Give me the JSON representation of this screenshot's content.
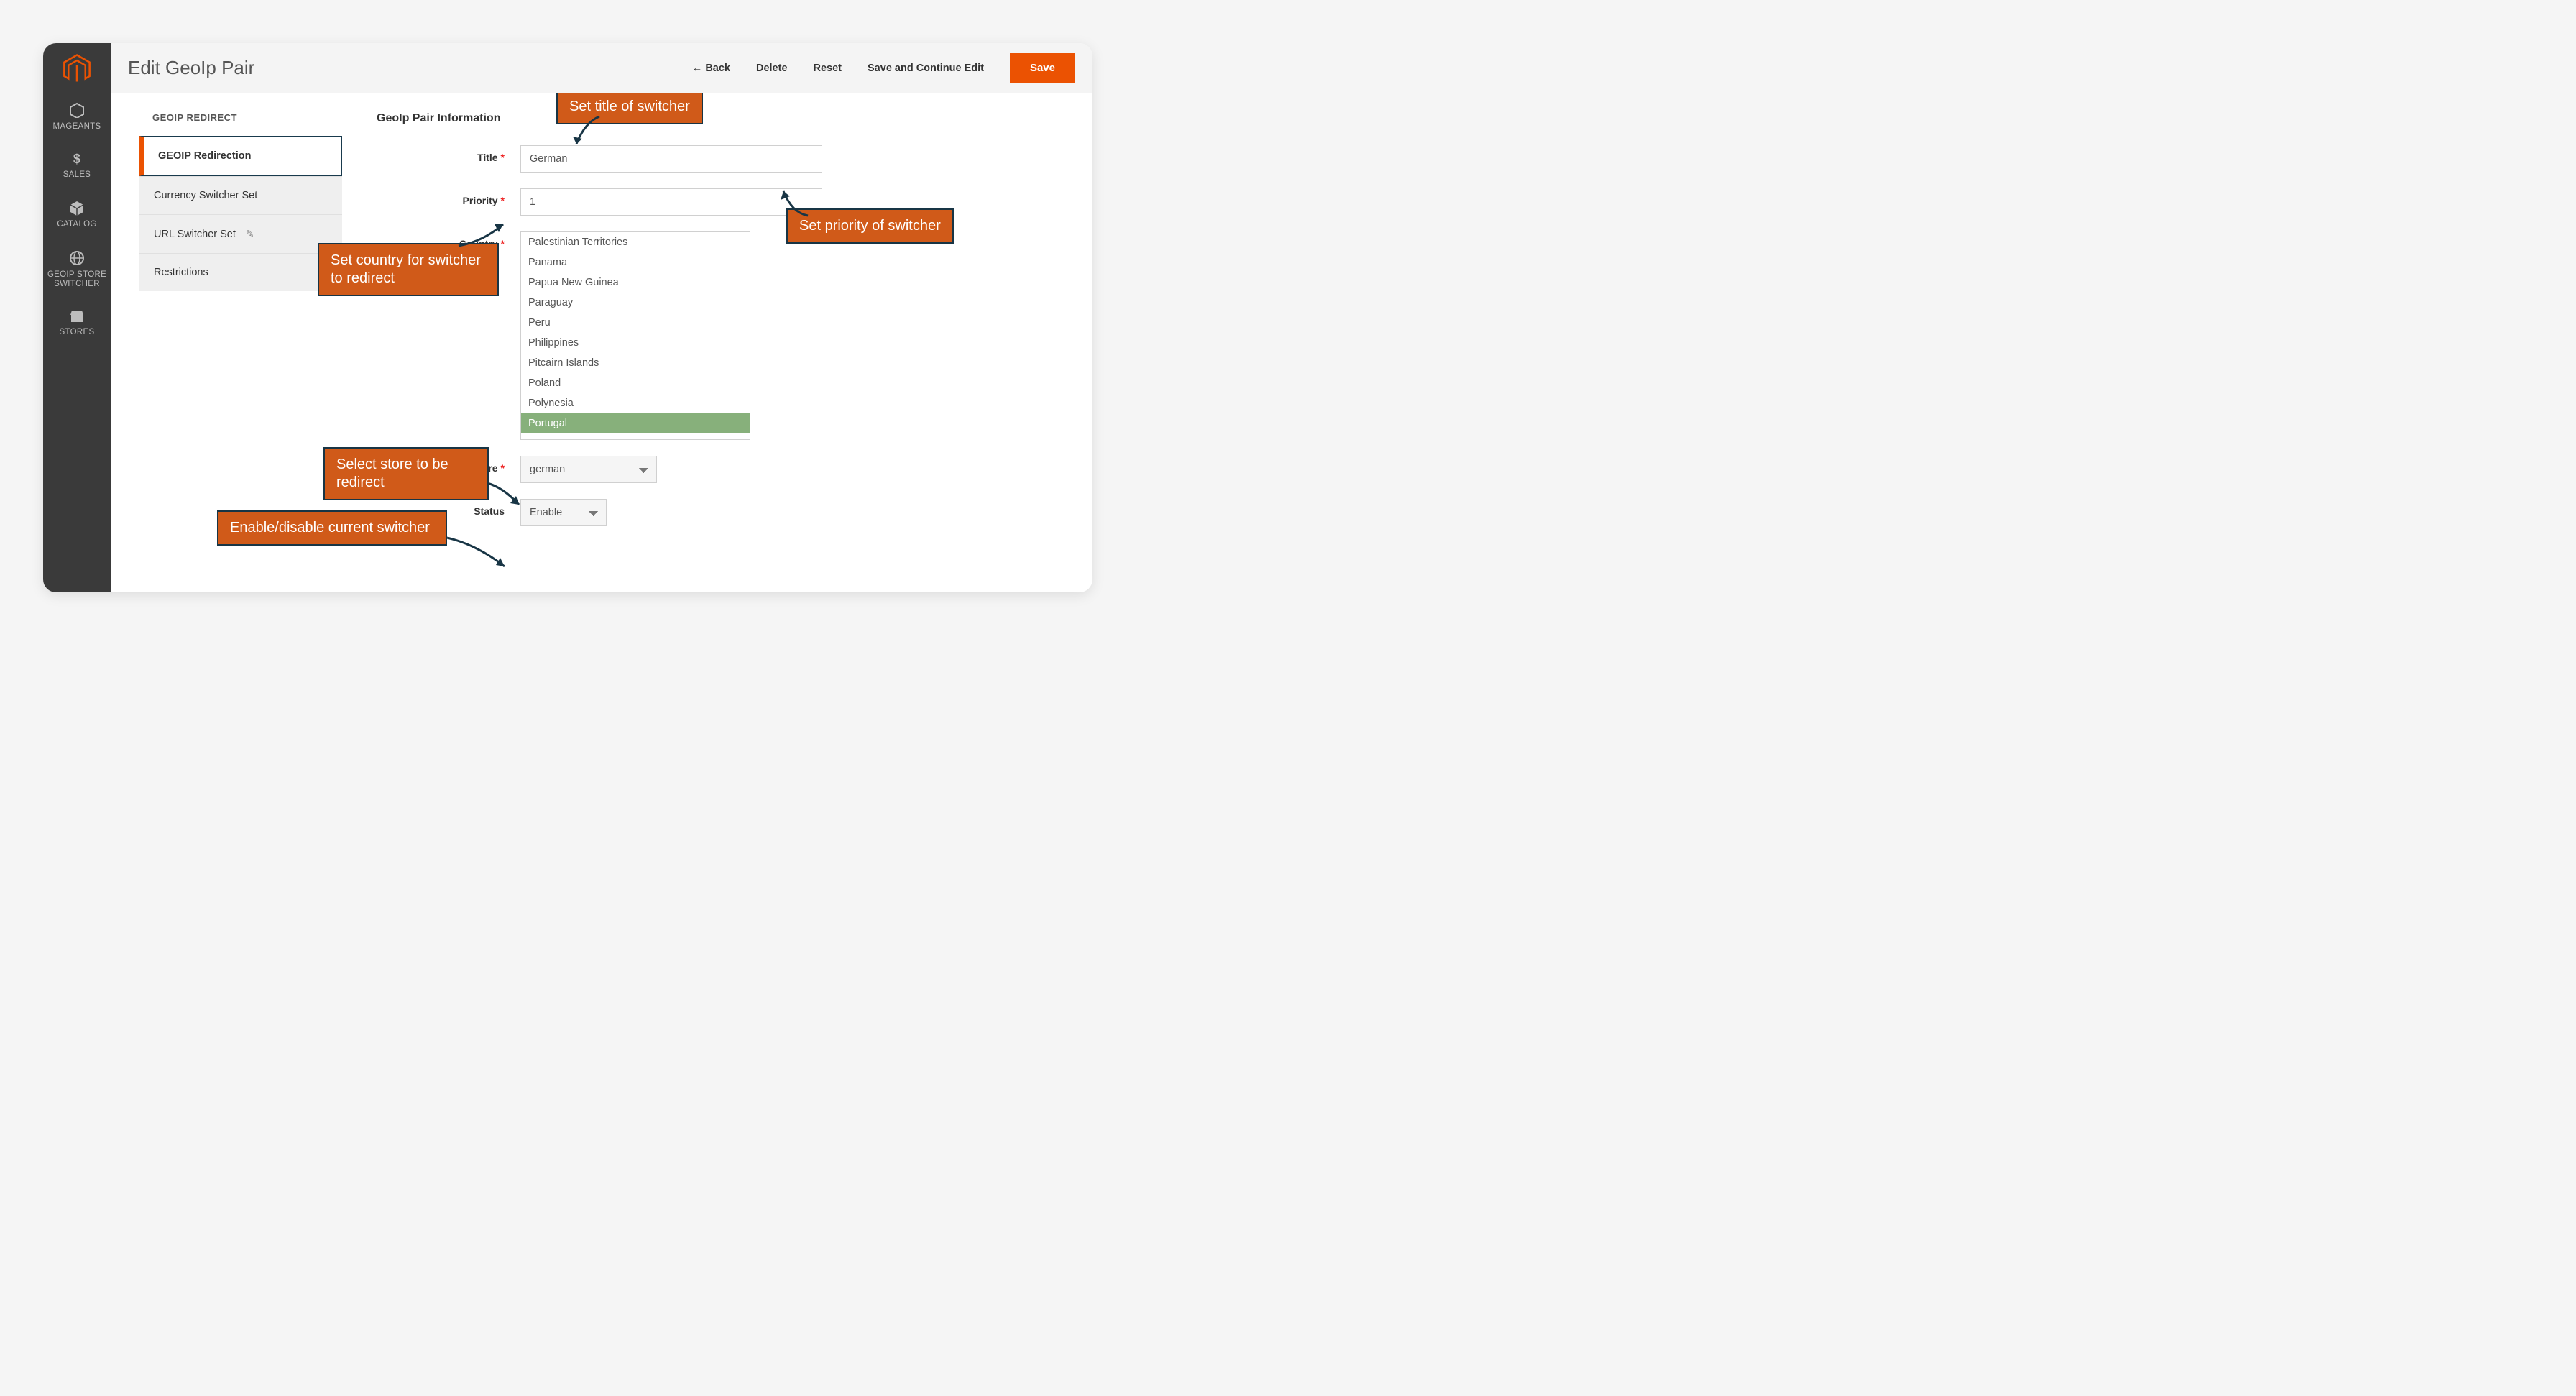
{
  "sidebar": {
    "items": [
      {
        "label": "MAGEANTS"
      },
      {
        "label": "SALES"
      },
      {
        "label": "CATALOG"
      },
      {
        "label": "GEOIP STORE SWITCHER"
      },
      {
        "label": "STORES"
      }
    ]
  },
  "header": {
    "title": "Edit GeoIp Pair",
    "back": "Back",
    "delete": "Delete",
    "reset": "Reset",
    "save_continue": "Save and Continue Edit",
    "save": "Save"
  },
  "tabs": {
    "heading": "GEOIP REDIRECT",
    "items": [
      {
        "label": "GEOIP Redirection",
        "active": true
      },
      {
        "label": "Currency Switcher Set"
      },
      {
        "label": "URL Switcher Set",
        "edit": true
      },
      {
        "label": "Restrictions"
      }
    ]
  },
  "form": {
    "section_title": "GeoIp Pair Information",
    "labels": {
      "title": "Title",
      "priority": "Priority",
      "country": "Country",
      "store": "Store",
      "status": "Status"
    },
    "values": {
      "title": "German",
      "priority": "1",
      "store": "german",
      "status": "Enable"
    },
    "countries": [
      "Palestinian Territories",
      "Panama",
      "Papua New Guinea",
      "Paraguay",
      "Peru",
      "Philippines",
      "Pitcairn Islands",
      "Poland",
      "Polynesia",
      "Portugal"
    ],
    "country_selected": "Portugal"
  },
  "annotations": {
    "title": "Set title of switcher",
    "priority": "Set priority of switcher",
    "country": "Set country for switcher to redirect",
    "store": "Select store to be redirect",
    "status": "Enable/disable current switcher"
  }
}
